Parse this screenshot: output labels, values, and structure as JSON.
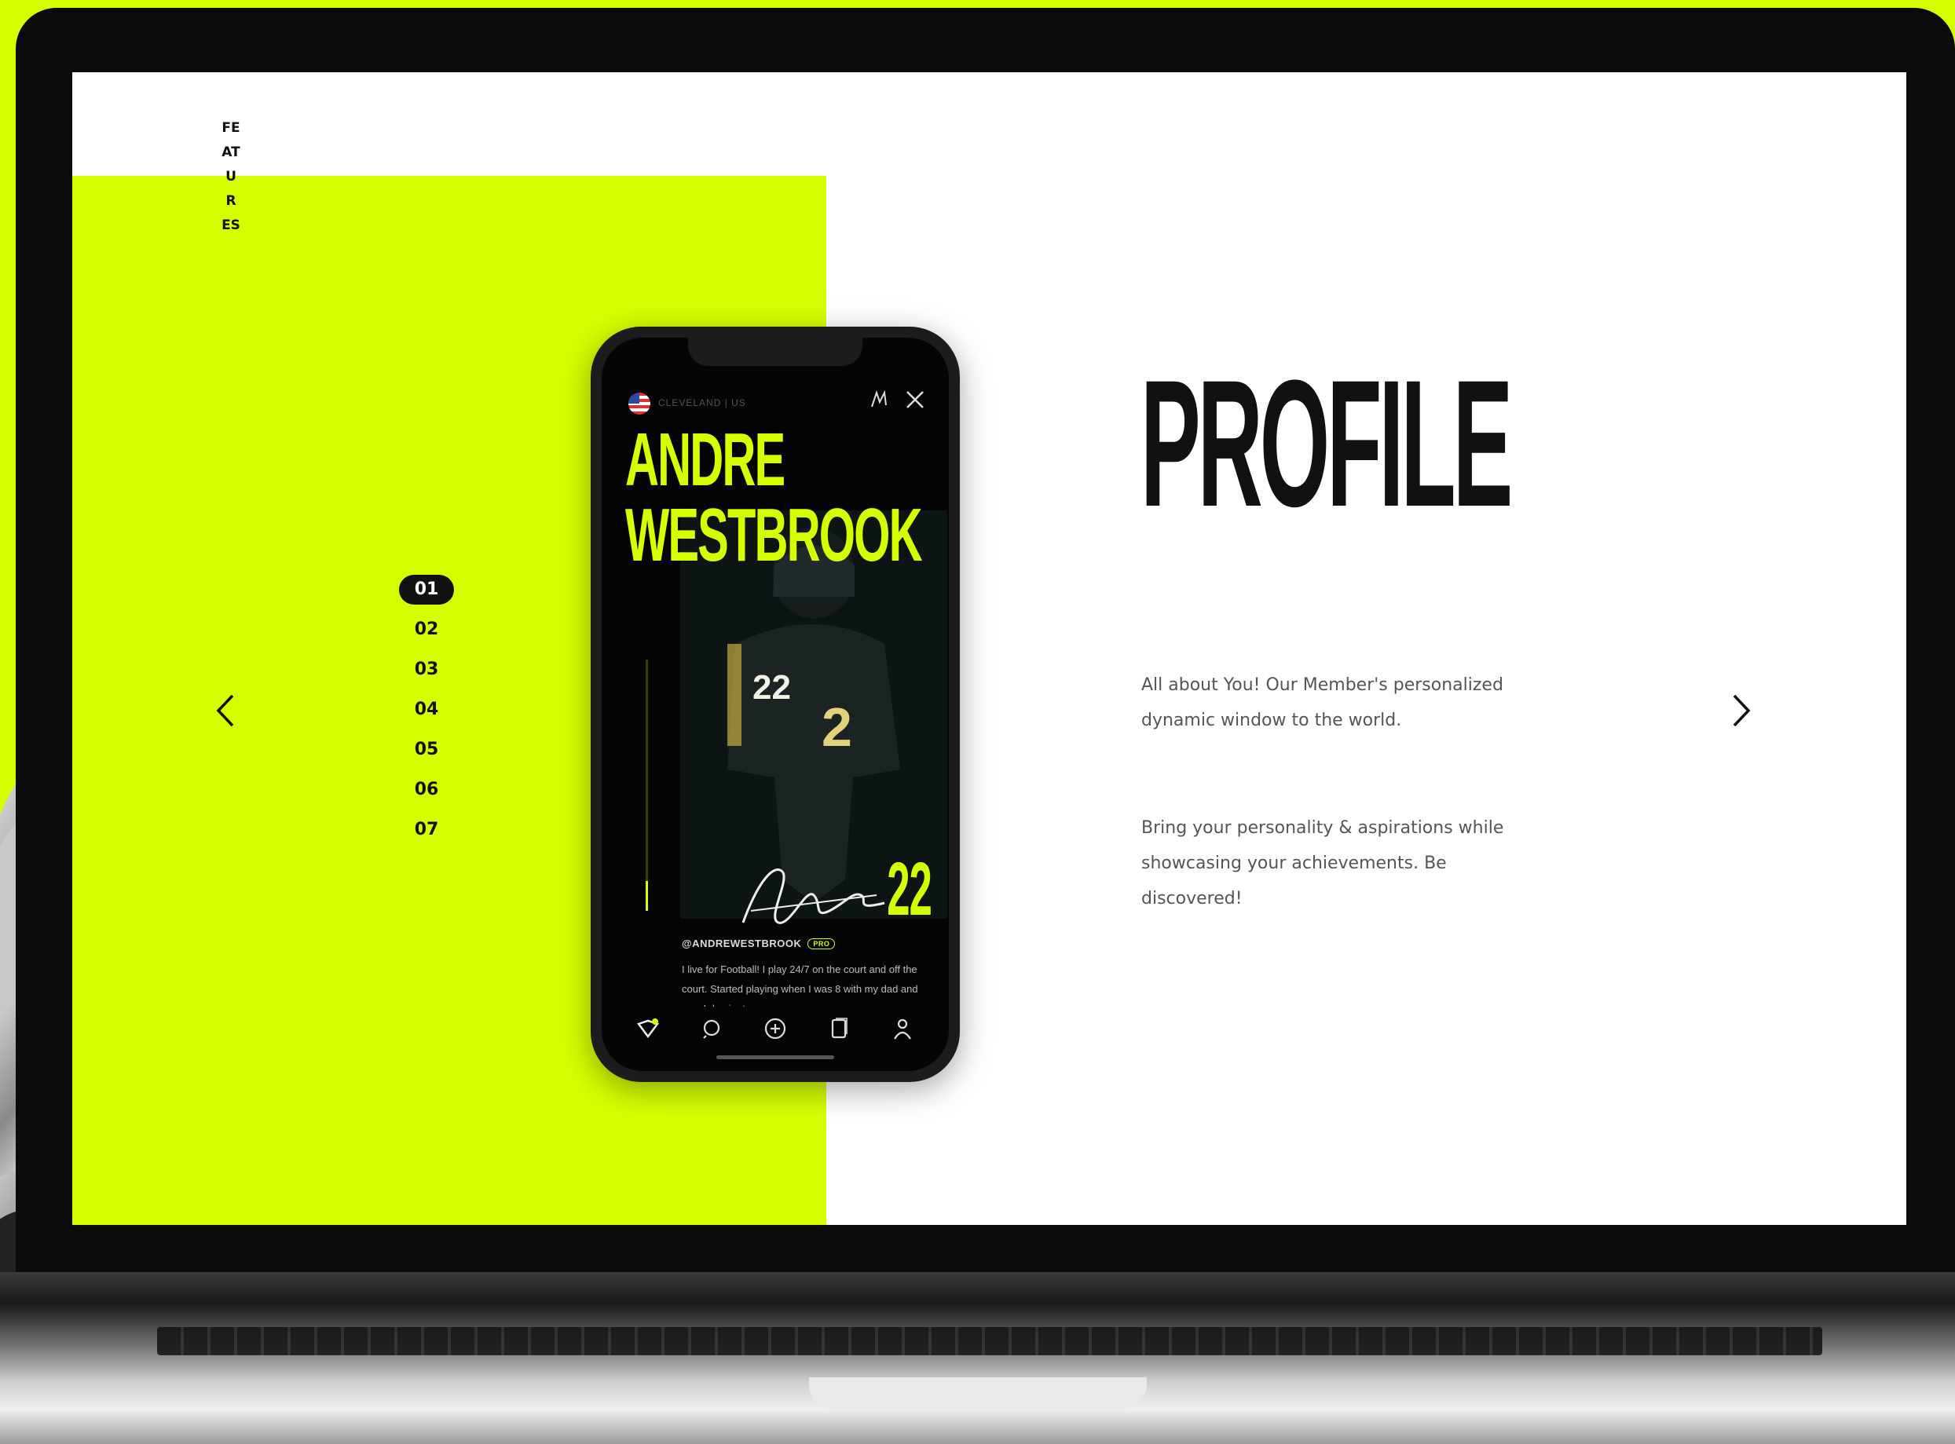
{
  "sidebar": {
    "vertical_label": "FEATURES"
  },
  "pager": {
    "items": [
      "01",
      "02",
      "03",
      "04",
      "05",
      "06",
      "07"
    ],
    "active": "01"
  },
  "phone": {
    "location": "CLEVELAND | US",
    "athlete_first": "ANDRE",
    "athlete_last": "WESTBROOK",
    "jersey_number": "22",
    "handle": "@ANDREWESTBROOK",
    "badge": "PRO",
    "bio": "I live for Football! I play 24/7 on the court and off the court. Started playing when I was 8 with my dad and now I dominate...",
    "progress_fraction": 0.12,
    "tabs": [
      "logo-icon",
      "search-icon",
      "add-icon",
      "document-icon",
      "profile-icon"
    ]
  },
  "content": {
    "title": "PROFILE",
    "paragraph_1": "All about You! Our Member's personalized dynamic window to the world.",
    "paragraph_2": "Bring your personality & aspirations while showcasing your achievements. Be discovered!"
  },
  "colors": {
    "accent": "#d6ff00",
    "dark": "#111111"
  }
}
